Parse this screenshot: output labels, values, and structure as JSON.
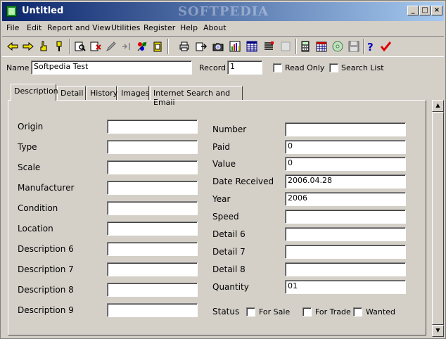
{
  "window": {
    "title": "Untitled",
    "watermark": "SOFTPEDIA"
  },
  "menu": [
    "File",
    "Edit",
    "Report and View",
    "Utilities",
    "Register",
    "Help",
    "About"
  ],
  "toolbar": {
    "icons": [
      "prev-record-icon",
      "next-record-icon",
      "hand-pointer-icon",
      "pin-icon",
      "find-icon",
      "cut-record-icon",
      "edit-icon",
      "sort-icon",
      "colors-icon",
      "clipboard-icon",
      "print-icon",
      "print-preview-icon",
      "camera-icon",
      "bar-chart-icon",
      "table-icon",
      "list-icon",
      "disabled-icon",
      "calculator-icon",
      "calendar-icon",
      "cd-icon",
      "save-icon",
      "help-icon",
      "check-icon"
    ]
  },
  "header": {
    "name_label": "Name",
    "name_value": "Softpedia Test",
    "record_label": "Record",
    "record_value": "1",
    "read_only_label": "Read Only",
    "search_list_label": "Search List"
  },
  "tabs": [
    "Description",
    "Detail",
    "History",
    "Images",
    "Internet Search and Email"
  ],
  "left_fields": [
    {
      "label": "Origin",
      "value": ""
    },
    {
      "label": "Type",
      "value": ""
    },
    {
      "label": "Scale",
      "value": ""
    },
    {
      "label": "Manufacturer",
      "value": ""
    },
    {
      "label": "Condition",
      "value": ""
    },
    {
      "label": "Location",
      "value": ""
    },
    {
      "label": "Description 6",
      "value": ""
    },
    {
      "label": "Description 7",
      "value": ""
    },
    {
      "label": "Description 8",
      "value": ""
    },
    {
      "label": "Description 9",
      "value": ""
    }
  ],
  "right_fields": [
    {
      "label": "Number",
      "value": ""
    },
    {
      "label": "Paid",
      "value": "0"
    },
    {
      "label": "Value",
      "value": "0"
    },
    {
      "label": "Date Received",
      "value": "2006.04.28"
    },
    {
      "label": "Year",
      "value": "2006"
    },
    {
      "label": "Speed",
      "value": ""
    },
    {
      "label": "Detail 6",
      "value": ""
    },
    {
      "label": "Detail 7",
      "value": ""
    },
    {
      "label": "Detail 8",
      "value": ""
    },
    {
      "label": "Quantity",
      "value": "01"
    }
  ],
  "status": {
    "label": "Status",
    "options": [
      "For Sale",
      "For Trade",
      "Wanted"
    ]
  }
}
